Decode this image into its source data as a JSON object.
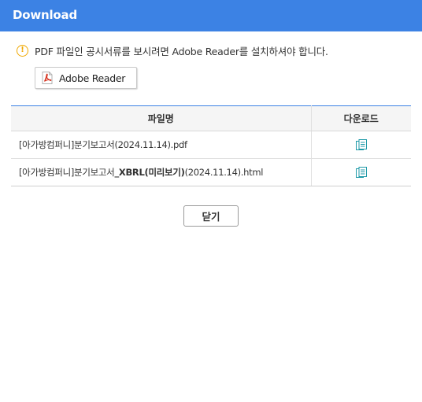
{
  "window": {
    "title": "Download"
  },
  "notice": {
    "icon": "warning-icon",
    "text": "PDF 파일인 공시서류를 보시려면 Adobe Reader를 설치하셔야 합니다."
  },
  "reader_button": {
    "label": "Adobe Reader",
    "icon": "pdf-icon"
  },
  "table": {
    "headers": {
      "name": "파일명",
      "download": "다운로드"
    },
    "rows": [
      {
        "prefix": "[아가방컴퍼니]분기보고서",
        "bold": "",
        "suffix": "(2024.11.14).pdf",
        "icon": "download-icon"
      },
      {
        "prefix": "[아가방컴퍼니]분기보고서",
        "bold": "_XBRL(미리보기)",
        "suffix": "(2024.11.14).html",
        "icon": "download-icon"
      }
    ]
  },
  "close_button": {
    "label": "닫기"
  },
  "colors": {
    "accent": "#3c82e4",
    "warning": "#f0a800",
    "pdf_red": "#d6321e",
    "download_teal": "#1f9aa8"
  }
}
